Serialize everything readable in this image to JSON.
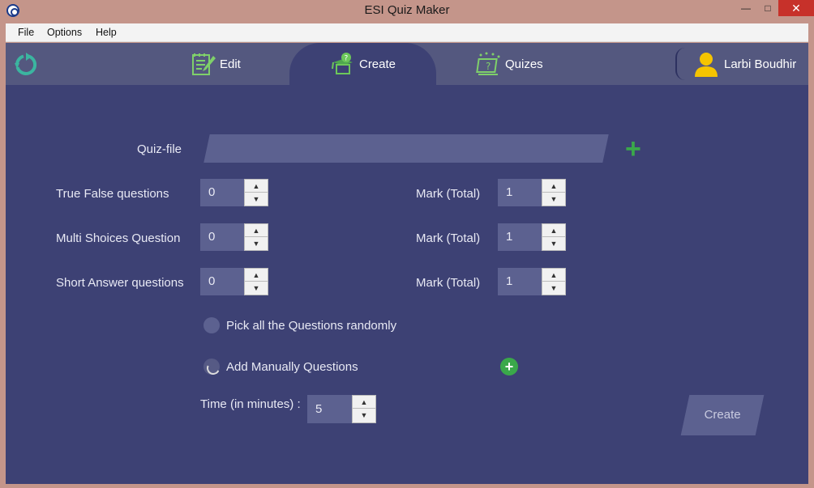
{
  "window": {
    "title": "ESI Quiz Maker",
    "minimize": "—",
    "maximize": "□",
    "close": "✕"
  },
  "menu": {
    "file": "File",
    "options": "Options",
    "help": "Help"
  },
  "nav": {
    "refresh_icon": "refresh-icon",
    "tabs": [
      {
        "label": "Edit",
        "icon": "notepad-pencil-icon",
        "active": false
      },
      {
        "label": "Create",
        "icon": "quiz-create-icon",
        "active": true
      },
      {
        "label": "Quizes",
        "icon": "quiz-board-icon",
        "active": false
      }
    ],
    "user": {
      "name": "Larbi Boudhir",
      "icon": "user-avatar-icon"
    }
  },
  "form": {
    "quiz_file_label": "Quiz-file",
    "quiz_file_value": "",
    "rows": [
      {
        "label": "True False questions",
        "count": "0",
        "mark_label": "Mark (Total)",
        "mark": "1"
      },
      {
        "label": "Multi Shoices Question",
        "count": "0",
        "mark_label": "Mark (Total)",
        "mark": "1"
      },
      {
        "label": "Short Answer questions",
        "count": "0",
        "mark_label": "Mark (Total)",
        "mark": "1"
      }
    ],
    "radio_random": "Pick all the Questions randomly",
    "radio_manual": "Add Manually Questions",
    "time_label": "Time (in minutes) :",
    "time_value": "5",
    "create_button": "Create"
  },
  "colors": {
    "accent_green": "#3aa84a",
    "main_bg": "#3d4174",
    "header_bg": "#54587f",
    "field_bg": "#5c6190"
  }
}
